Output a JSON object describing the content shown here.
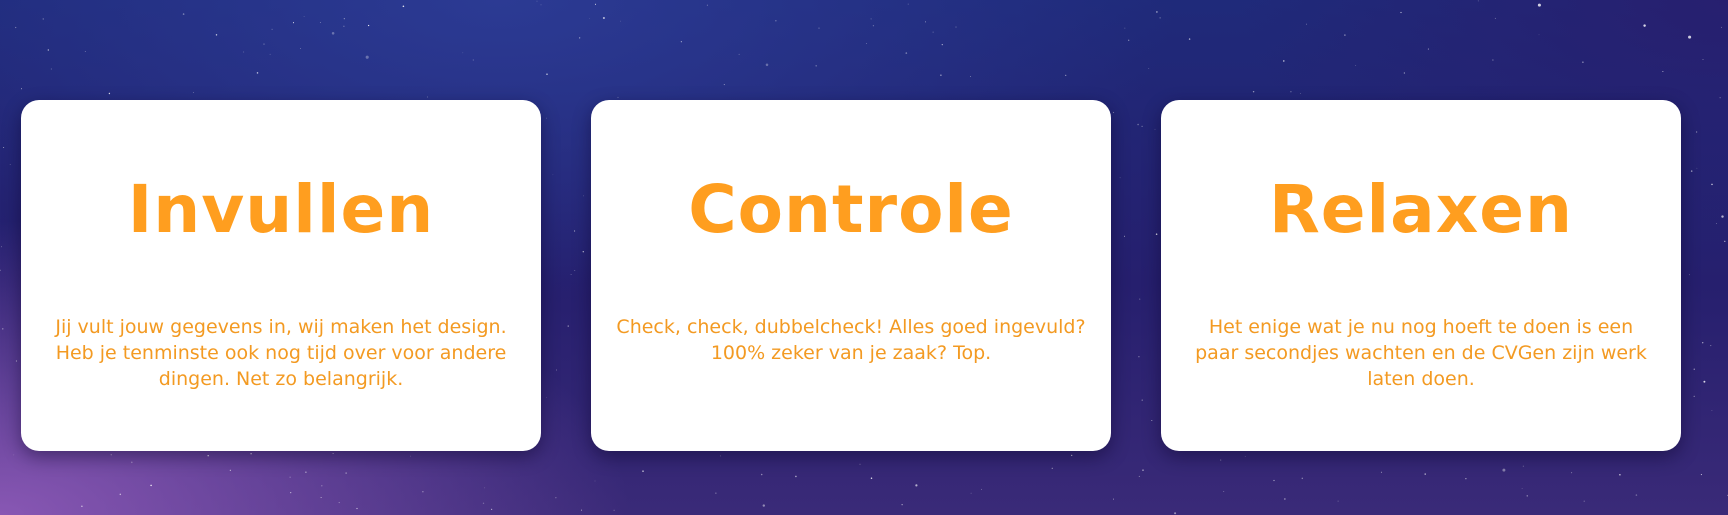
{
  "cards": [
    {
      "title": "Invullen",
      "text": "Jij vult jouw gegevens in, wij maken het design. Heb je tenminste ook nog tijd over voor andere dingen. Net zo belangrijk."
    },
    {
      "title": "Controle",
      "text": "Check, check, dubbelcheck! Alles goed ingevuld?\n100% zeker van je zaak? Top."
    },
    {
      "title": "Relaxen",
      "text": "Het enige wat je nu nog hoeft te doen is een paar secondjes wachten en de CVGen zijn werk laten doen."
    }
  ],
  "colors": {
    "accent": "#ff9e1f",
    "card_background": "#ffffff",
    "background_top": "#1f2a7a",
    "background_bottom_left": "#965fbe"
  }
}
